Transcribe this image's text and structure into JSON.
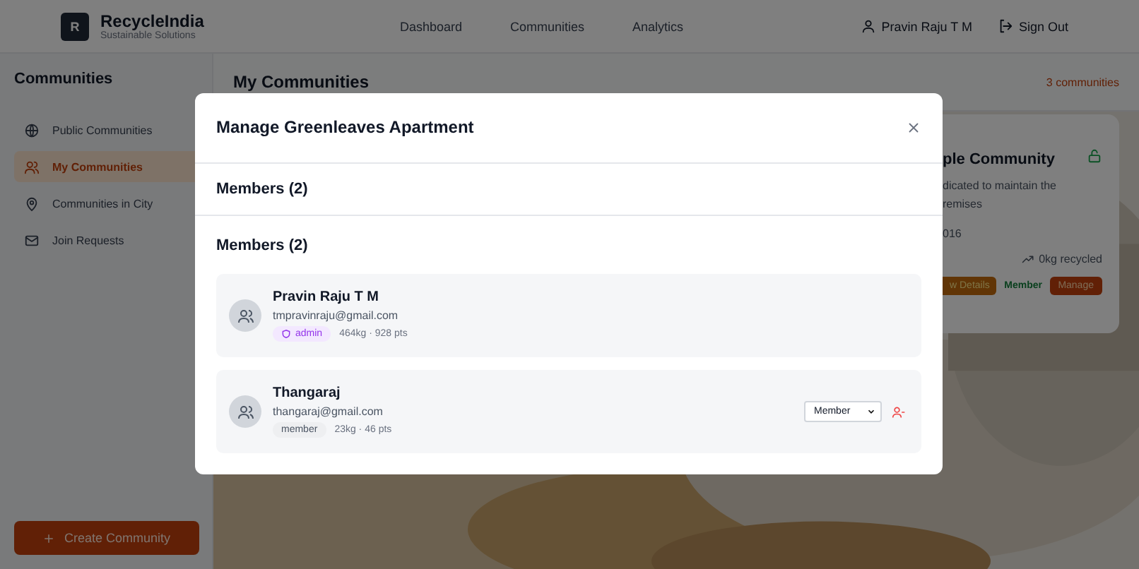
{
  "header": {
    "logo_letter": "R",
    "brand": "RecycleIndia",
    "tagline": "Sustainable Solutions",
    "nav": [
      {
        "label": "Dashboard"
      },
      {
        "label": "Communities"
      },
      {
        "label": "Analytics"
      }
    ],
    "user": "Pravin Raju T M",
    "sign_out": "Sign Out"
  },
  "sidebar": {
    "title": "Communities",
    "items": [
      {
        "label": "Public Communities",
        "kind": "globe",
        "selected": false
      },
      {
        "label": "My Communities",
        "kind": "users",
        "selected": true
      },
      {
        "label": "Communities in City",
        "kind": "pin",
        "selected": false
      },
      {
        "label": "Join Requests",
        "kind": "mail",
        "selected": false
      }
    ],
    "create_button": "Create Community"
  },
  "main": {
    "title": "My Communities",
    "count": "3 communities",
    "card": {
      "title": "ple Community",
      "description_lines": [
        "dicated to maintain the",
        "remises"
      ],
      "date": "016",
      "recycled": "0kg recycled",
      "details_button": "w Details",
      "status": "Member",
      "manage_button": "Manage"
    }
  },
  "modal": {
    "title": "Manage Greenleaves Apartment",
    "section_tab": "Members (2)",
    "section_title": "Members (2)",
    "members": [
      {
        "name": "Pravin Raju T M",
        "email": "tmpravinraju@gmail.com",
        "role": "admin",
        "kind": "admin",
        "stats": "464kg · 928 pts",
        "editable": false
      },
      {
        "name": "Thangaraj",
        "email": "thangaraj@gmail.com",
        "role": "member",
        "kind": "member",
        "stats": "23kg · 46 pts",
        "editable": true,
        "role_select": "Member"
      }
    ]
  }
}
